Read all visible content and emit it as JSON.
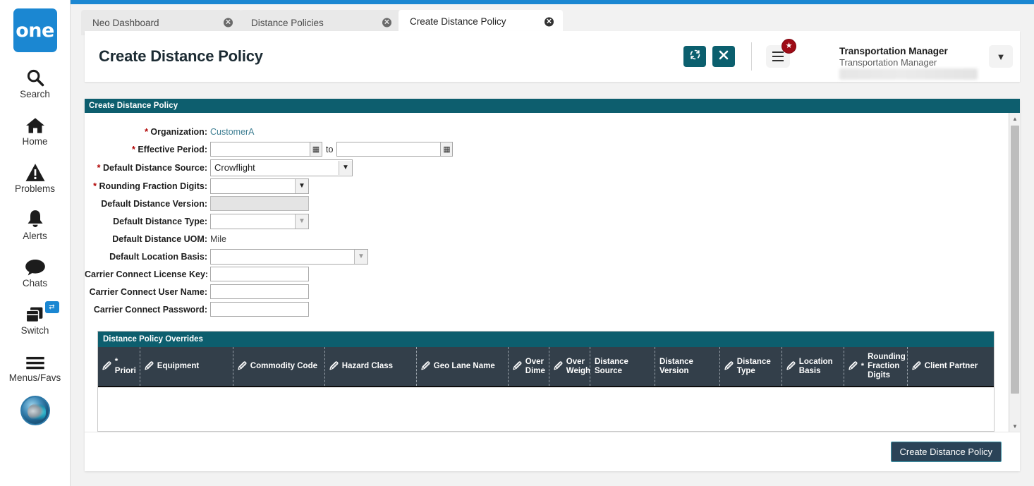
{
  "colors": {
    "accent_blue": "#1b87d2",
    "teal": "#0d5e6e",
    "teal_button": "#0b5f6e",
    "grid_header": "#333f4a",
    "badge_red": "#9e0b16",
    "primary_button": "#2b4357"
  },
  "sidebar": {
    "logo_text": "one",
    "items": [
      {
        "label": "Search",
        "icon": "search-icon"
      },
      {
        "label": "Home",
        "icon": "home-icon"
      },
      {
        "label": "Problems",
        "icon": "warning-triangle-icon"
      },
      {
        "label": "Alerts",
        "icon": "bell-icon"
      },
      {
        "label": "Chats",
        "icon": "chat-bubble-icon"
      },
      {
        "label": "Switch",
        "icon": "windows-switch-icon",
        "badge_icon": "swap-arrows-icon"
      },
      {
        "label": "Menus/Favs",
        "icon": "hamburger-icon"
      }
    ],
    "avatar_alt": "user-avatar"
  },
  "tabs": [
    {
      "label": "Neo Dashboard",
      "active": false,
      "close_icon": "close-circle-icon"
    },
    {
      "label": "Distance Policies",
      "active": false,
      "close_icon": "close-circle-icon"
    },
    {
      "label": "Create Distance Policy",
      "active": true,
      "close_icon": "close-circle-icon"
    }
  ],
  "header": {
    "title": "Create Distance Policy",
    "refresh_icon": "refresh-icon",
    "close_icon": "close-x-icon",
    "menu_icon": "hamburger-menu-icon",
    "menu_badge_icon": "star-icon",
    "user_name": "Transportation Manager",
    "user_role": "Transportation Manager",
    "user_caret_icon": "chevron-down-icon"
  },
  "panel": {
    "title": "Create Distance Policy"
  },
  "form": {
    "rows": [
      {
        "label": "Organization",
        "required": true,
        "type": "link",
        "value": "CustomerA"
      },
      {
        "label": "Effective Period",
        "required": true,
        "type": "daterange",
        "from": "",
        "to": "",
        "separator": "to",
        "calendar_icon": "calendar-icon"
      },
      {
        "label": "Default Distance Source",
        "required": true,
        "type": "select",
        "value": "Crowflight"
      },
      {
        "label": "Rounding Fraction Digits",
        "required": true,
        "type": "select",
        "value": ""
      },
      {
        "label": "Default Distance Version",
        "required": false,
        "type": "readonly",
        "value": ""
      },
      {
        "label": "Default Distance Type",
        "required": false,
        "type": "select-disabled",
        "value": ""
      },
      {
        "label": "Default Distance UOM",
        "required": false,
        "type": "text",
        "value": "Mile"
      },
      {
        "label": "Default Location Basis",
        "required": false,
        "type": "select-disabled",
        "value": ""
      },
      {
        "label": "Carrier Connect License Key",
        "required": false,
        "type": "input",
        "value": ""
      },
      {
        "label": "Carrier Connect User Name",
        "required": false,
        "type": "input",
        "value": ""
      },
      {
        "label": "Carrier Connect Password",
        "required": false,
        "type": "input",
        "value": ""
      }
    ]
  },
  "overrides_grid": {
    "title": "Distance Policy Overrides",
    "edit_icon": "edit-pencil-icon",
    "columns": [
      {
        "label": "* Priori",
        "editable": true,
        "required": true,
        "width": 60
      },
      {
        "label": "Equipment",
        "editable": true,
        "required": false,
        "width": 132
      },
      {
        "label": "Commodity Code",
        "editable": true,
        "required": false,
        "width": 130
      },
      {
        "label": "Hazard Class",
        "editable": true,
        "required": false,
        "width": 130
      },
      {
        "label": "Geo Lane Name",
        "editable": true,
        "required": false,
        "width": 130
      },
      {
        "label": "Over Dime",
        "editable": true,
        "required": false,
        "width": 58
      },
      {
        "label": "Over Weigh",
        "editable": true,
        "required": false,
        "width": 58
      },
      {
        "label": "Distance Source",
        "editable": false,
        "required": false,
        "width": 92
      },
      {
        "label": "Distance Version",
        "editable": false,
        "required": false,
        "width": 92
      },
      {
        "label": "Distance Type",
        "editable": true,
        "required": false,
        "width": 88
      },
      {
        "label": "Location Basis",
        "editable": true,
        "required": false,
        "width": 88
      },
      {
        "label": "Rounding Fraction Digits",
        "editable": true,
        "required": true,
        "width": 90
      },
      {
        "label": "Client Partner",
        "editable": true,
        "required": false,
        "width": 122
      }
    ],
    "rows": []
  },
  "footer": {
    "submit_label": "Create Distance Policy"
  },
  "scrollbar": {
    "up_icon": "triangle-up-icon",
    "down_icon": "triangle-down-icon"
  }
}
